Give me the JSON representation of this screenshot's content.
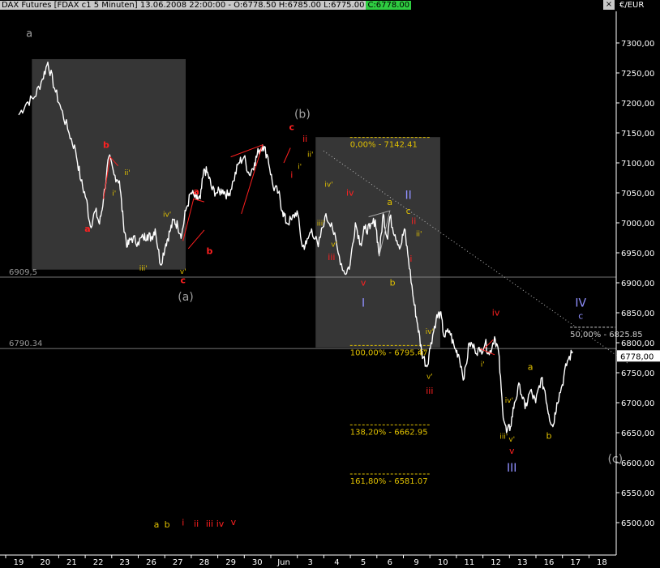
{
  "header": {
    "title": "DAX Futures [FDAX c1  5 Minuten] 13.06.2008 22:00:00 - O:6778.50 H:6785.00 L:6775.00",
    "close": "C:6778.00",
    "unit": "€/EUR",
    "window_button": "×"
  },
  "colors": {
    "background": "#000000",
    "price": "#ffffff",
    "red_labels": "#ff2020",
    "yellow_labels": "#e0c000",
    "purple_labels": "#9090ff",
    "gray_labels": "#a0a0a0",
    "box": "#404040",
    "close_box": "#ffffff"
  },
  "chart_data": {
    "type": "line",
    "ylim": [
      6460,
      7340
    ],
    "y_ticks": [
      "7300,00",
      "7250,00",
      "7200,00",
      "7150,00",
      "7100,00",
      "7050,00",
      "7000,00",
      "6950,00",
      "6900,00",
      "6850,00",
      "6800,00",
      "6750,00",
      "6700,00",
      "6650,00",
      "6600,00",
      "6550,00",
      "6500,00"
    ],
    "y_tick_values": [
      7300,
      7250,
      7200,
      7150,
      7100,
      7050,
      7000,
      6950,
      6900,
      6850,
      6800,
      6750,
      6700,
      6650,
      6600,
      6550,
      6500
    ],
    "x_ticks": [
      "19",
      "20",
      "21",
      "22",
      "23",
      "26",
      "27",
      "28",
      "29",
      "30",
      "Jun",
      "3",
      "4",
      "5",
      "6",
      "9",
      "10",
      "11",
      "12",
      "13",
      "16",
      "17",
      "18"
    ],
    "last_price_label": "6778,00",
    "last_price": 6778,
    "series": [
      {
        "values": [
          [
            19.0,
            7180
          ],
          [
            19.3,
            7200
          ],
          [
            19.6,
            7210
          ],
          [
            19.9,
            7240
          ],
          [
            20.1,
            7268
          ],
          [
            20.35,
            7225
          ],
          [
            20.6,
            7190
          ],
          [
            20.9,
            7150
          ],
          [
            21.15,
            7120
          ],
          [
            21.35,
            7070
          ],
          [
            21.55,
            7040
          ],
          [
            21.7,
            6995
          ],
          [
            21.9,
            7020
          ],
          [
            22.05,
            6998
          ],
          [
            22.2,
            7040
          ],
          [
            22.4,
            7110
          ],
          [
            22.6,
            7080
          ],
          [
            22.8,
            7070
          ],
          [
            22.95,
            7000
          ],
          [
            23.1,
            6960
          ],
          [
            23.25,
            6975
          ],
          [
            23.5,
            6968
          ],
          [
            23.7,
            6975
          ],
          [
            23.85,
            6980
          ],
          [
            24.0,
            6975
          ],
          [
            24.15,
            6990
          ],
          [
            24.35,
            6930
          ],
          [
            24.55,
            6965
          ],
          [
            24.7,
            6985
          ],
          [
            24.85,
            7005
          ],
          [
            25.0,
            6995
          ],
          [
            25.15,
            6980
          ],
          [
            25.3,
            7020
          ],
          [
            25.5,
            7050
          ],
          [
            25.7,
            7040
          ],
          [
            25.85,
            7040
          ],
          [
            26.0,
            7090
          ],
          [
            26.15,
            7080
          ],
          [
            26.3,
            7055
          ],
          [
            26.5,
            7050
          ],
          [
            26.7,
            7055
          ],
          [
            26.9,
            7045
          ],
          [
            27.1,
            7070
          ],
          [
            27.3,
            7100
          ],
          [
            27.5,
            7110
          ],
          [
            27.7,
            7080
          ],
          [
            27.9,
            7100
          ],
          [
            28.05,
            7120
          ],
          [
            28.2,
            7130
          ],
          [
            28.4,
            7110
          ],
          [
            28.6,
            7060
          ],
          [
            28.8,
            7050
          ],
          [
            28.95,
            7020
          ],
          [
            29.1,
            7000
          ],
          [
            29.3,
            7005
          ],
          [
            29.5,
            7020
          ],
          [
            29.7,
            6960
          ],
          [
            29.85,
            6965
          ],
          [
            30.05,
            6990
          ],
          [
            30.3,
            6960
          ],
          [
            30.55,
            7010
          ],
          [
            30.8,
            7000
          ],
          [
            31.05,
            6950
          ],
          [
            31.3,
            6915
          ],
          [
            31.5,
            6930
          ],
          [
            31.7,
            7000
          ],
          [
            31.9,
            6965
          ],
          [
            32.05,
            6990
          ],
          [
            32.25,
            6990
          ],
          [
            32.45,
            7005
          ],
          [
            32.6,
            6945
          ],
          [
            32.75,
            7015
          ],
          [
            32.9,
            6975
          ],
          [
            33.0,
            7010
          ],
          [
            33.2,
            6980
          ],
          [
            33.4,
            6960
          ],
          [
            33.55,
            6990
          ],
          [
            33.7,
            6940
          ],
          [
            33.9,
            6870
          ],
          [
            34.05,
            6830
          ],
          [
            34.2,
            6785
          ],
          [
            34.4,
            6760
          ],
          [
            34.55,
            6800
          ],
          [
            34.75,
            6840
          ],
          [
            34.9,
            6850
          ],
          [
            35.05,
            6810
          ],
          [
            35.25,
            6820
          ],
          [
            35.45,
            6790
          ],
          [
            35.6,
            6780
          ],
          [
            35.8,
            6740
          ],
          [
            36.0,
            6800
          ],
          [
            36.2,
            6790
          ],
          [
            36.4,
            6785
          ],
          [
            36.6,
            6800
          ],
          [
            36.75,
            6780
          ],
          [
            36.95,
            6810
          ],
          [
            37.1,
            6785
          ],
          [
            37.25,
            6690
          ],
          [
            37.4,
            6650
          ],
          [
            37.55,
            6660
          ],
          [
            37.7,
            6700
          ],
          [
            37.9,
            6730
          ],
          [
            38.1,
            6690
          ],
          [
            38.3,
            6720
          ],
          [
            38.5,
            6700
          ],
          [
            38.7,
            6740
          ],
          [
            38.85,
            6720
          ],
          [
            39.0,
            6680
          ],
          [
            39.15,
            6660
          ],
          [
            39.3,
            6700
          ],
          [
            39.5,
            6730
          ],
          [
            39.7,
            6770
          ],
          [
            39.9,
            6785
          ]
        ]
      }
    ],
    "boxes": [
      {
        "x0": 19.5,
        "x1": 25.3,
        "y0": 6922,
        "y1": 7273
      },
      {
        "x0": 30.2,
        "x1": 34.9,
        "y0": 6792,
        "y1": 7143
      }
    ],
    "h_levels": [
      {
        "y": 6909.5,
        "label": "6909,5"
      },
      {
        "y": 6790.34,
        "label": "6790.34"
      }
    ],
    "fib_levels": [
      {
        "y": 7142.41,
        "label": "0,00% - 7142.41",
        "x0": 31.5,
        "x1": 34.5
      },
      {
        "y": 6795.47,
        "label": "100,00% - 6795.47",
        "x0": 31.5,
        "x1": 34.5
      },
      {
        "y": 6662.95,
        "label": "138,20% - 6662.95",
        "x0": 31.5,
        "x1": 34.5
      },
      {
        "y": 6581.07,
        "label": "161,80% - 6581.07",
        "x0": 31.5,
        "x1": 34.5
      },
      {
        "y": 6825.85,
        "label": "50,00% - 6825.85",
        "x0": 39.8,
        "x1": 41.5
      }
    ],
    "trendline": [
      [
        30.5,
        7120
      ],
      [
        42.0,
        6765
      ]
    ],
    "wave_lines": [
      [
        [
          22.2,
          7040
        ],
        [
          22.45,
          7110
        ],
        [
          22.75,
          7095
        ]
      ],
      [
        [
          25.2,
          6970
        ],
        [
          25.6,
          7040
        ],
        [
          26.0,
          7035
        ]
      ],
      [
        [
          25.4,
          6957
        ],
        [
          26.0,
          6988
        ]
      ],
      [
        [
          27.0,
          7110
        ],
        [
          28.2,
          7130
        ],
        [
          27.4,
          7015
        ]
      ],
      [
        [
          29.0,
          7100
        ],
        [
          29.25,
          7125
        ]
      ],
      [
        [
          32.2,
          7010
        ],
        [
          33.0,
          7020
        ],
        [
          32.6,
          6945
        ]
      ],
      [
        [
          36.55,
          6790
        ],
        [
          36.9,
          6805
        ]
      ],
      [
        [
          36.4,
          6790
        ],
        [
          36.95,
          6780
        ]
      ]
    ],
    "annotations": [
      {
        "text": "a",
        "x": 19.4,
        "y": 7310,
        "color": "gray",
        "size": 13
      },
      {
        "text": "(b)",
        "x": 29.7,
        "y": 7175,
        "color": "gray",
        "size": 14
      },
      {
        "text": "(a)",
        "x": 25.3,
        "y": 6870,
        "color": "gray",
        "size": 14
      },
      {
        "text": "(c)",
        "x": 41.5,
        "y": 6600,
        "color": "gray",
        "size": 14
      },
      {
        "text": "b",
        "x": 22.3,
        "y": 7125,
        "color": "red",
        "size": 11
      },
      {
        "text": "a",
        "x": 21.6,
        "y": 6985,
        "color": "red",
        "size": 11
      },
      {
        "text": "ii'",
        "x": 23.1,
        "y": 7080,
        "color": "yellow",
        "size": 9
      },
      {
        "text": "i'",
        "x": 22.6,
        "y": 7045,
        "color": "yellow",
        "size": 9
      },
      {
        "text": "iii'",
        "x": 23.7,
        "y": 6920,
        "color": "yellow",
        "size": 9
      },
      {
        "text": "iv'",
        "x": 24.6,
        "y": 7010,
        "color": "yellow",
        "size": 9
      },
      {
        "text": "v'",
        "x": 25.2,
        "y": 6915,
        "color": "yellow",
        "size": 9
      },
      {
        "text": "c",
        "x": 25.2,
        "y": 6899,
        "color": "red",
        "size": 11
      },
      {
        "text": "a",
        "x": 25.7,
        "y": 7047,
        "color": "red",
        "size": 11
      },
      {
        "text": "b",
        "x": 26.2,
        "y": 6948,
        "color": "red",
        "size": 11
      },
      {
        "text": "c",
        "x": 29.3,
        "y": 7155,
        "color": "red",
        "size": 11
      },
      {
        "text": "ii",
        "x": 29.8,
        "y": 7135,
        "color": "red",
        "size": 11
      },
      {
        "text": "ii'",
        "x": 30.0,
        "y": 7110,
        "color": "yellow",
        "size": 9
      },
      {
        "text": "i'",
        "x": 29.6,
        "y": 7090,
        "color": "yellow",
        "size": 9
      },
      {
        "text": "i",
        "x": 29.3,
        "y": 7075,
        "color": "red",
        "size": 11
      },
      {
        "text": "iv'",
        "x": 30.7,
        "y": 7060,
        "color": "yellow",
        "size": 9
      },
      {
        "text": "iv",
        "x": 31.5,
        "y": 7045,
        "color": "red",
        "size": 11
      },
      {
        "text": "iii'",
        "x": 30.4,
        "y": 6995,
        "color": "yellow",
        "size": 9
      },
      {
        "text": "v'",
        "x": 30.9,
        "y": 6960,
        "color": "yellow",
        "size": 9
      },
      {
        "text": "iii",
        "x": 30.8,
        "y": 6938,
        "color": "red",
        "size": 11
      },
      {
        "text": "v",
        "x": 32.0,
        "y": 6895,
        "color": "red",
        "size": 11
      },
      {
        "text": "I",
        "x": 32.0,
        "y": 6860,
        "color": "purple",
        "size": 14
      },
      {
        "text": "a",
        "x": 33.0,
        "y": 7030,
        "color": "yellow",
        "size": 11
      },
      {
        "text": "b",
        "x": 33.1,
        "y": 6895,
        "color": "yellow",
        "size": 11
      },
      {
        "text": "II",
        "x": 33.7,
        "y": 7040,
        "color": "purple",
        "size": 14
      },
      {
        "text": "c",
        "x": 33.7,
        "y": 7015,
        "color": "yellow",
        "size": 11
      },
      {
        "text": "ii",
        "x": 33.9,
        "y": 6998,
        "color": "red",
        "size": 11
      },
      {
        "text": "ii'",
        "x": 34.1,
        "y": 6978,
        "color": "yellow",
        "size": 9
      },
      {
        "text": "i",
        "x": 33.8,
        "y": 6935,
        "color": "red",
        "size": 11
      },
      {
        "text": "iv'",
        "x": 34.5,
        "y": 6815,
        "color": "yellow",
        "size": 9
      },
      {
        "text": "iii'",
        "x": 34.2,
        "y": 6780,
        "color": "yellow",
        "size": 9
      },
      {
        "text": "v'",
        "x": 34.5,
        "y": 6740,
        "color": "yellow",
        "size": 9
      },
      {
        "text": "iii",
        "x": 34.5,
        "y": 6715,
        "color": "red",
        "size": 11
      },
      {
        "text": "iv",
        "x": 37.0,
        "y": 6845,
        "color": "red",
        "size": 11
      },
      {
        "text": "i'",
        "x": 36.5,
        "y": 6760,
        "color": "yellow",
        "size": 9
      },
      {
        "text": "iv'",
        "x": 37.5,
        "y": 6700,
        "color": "yellow",
        "size": 9
      },
      {
        "text": "iii'",
        "x": 37.3,
        "y": 6640,
        "color": "yellow",
        "size": 9
      },
      {
        "text": "v'",
        "x": 37.6,
        "y": 6635,
        "color": "yellow",
        "size": 9
      },
      {
        "text": "v",
        "x": 37.6,
        "y": 6615,
        "color": "red",
        "size": 11
      },
      {
        "text": "III",
        "x": 37.6,
        "y": 6585,
        "color": "purple",
        "size": 14
      },
      {
        "text": "a",
        "x": 38.3,
        "y": 6755,
        "color": "yellow",
        "size": 11
      },
      {
        "text": "b",
        "x": 39.0,
        "y": 6640,
        "color": "yellow",
        "size": 11
      },
      {
        "text": "IV",
        "x": 40.2,
        "y": 6860,
        "color": "purple",
        "size": 14
      },
      {
        "text": "c",
        "x": 40.2,
        "y": 6840,
        "color": "purple",
        "size": 11
      },
      {
        "text": "a",
        "x": 24.2,
        "y": 6492,
        "color": "yellow",
        "size": 11
      },
      {
        "text": "b",
        "x": 24.6,
        "y": 6492,
        "color": "yellow",
        "size": 11
      },
      {
        "text": "i",
        "x": 25.2,
        "y": 6495,
        "color": "red",
        "size": 11
      },
      {
        "text": "ii",
        "x": 25.7,
        "y": 6493,
        "color": "red",
        "size": 11
      },
      {
        "text": "iii",
        "x": 26.2,
        "y": 6493,
        "color": "red",
        "size": 11
      },
      {
        "text": "iv",
        "x": 26.6,
        "y": 6493,
        "color": "red",
        "size": 11
      },
      {
        "text": "v",
        "x": 27.1,
        "y": 6496,
        "color": "red",
        "size": 11
      }
    ]
  }
}
